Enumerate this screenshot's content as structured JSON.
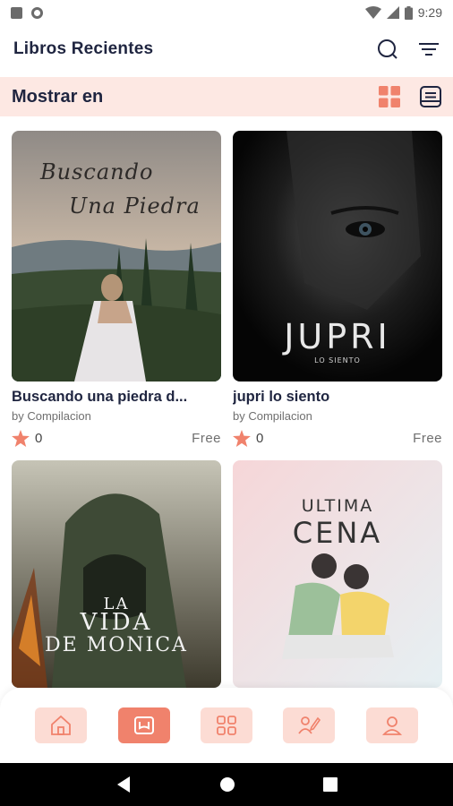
{
  "status_bar": {
    "time": "9:29",
    "icons": [
      "sim-icon",
      "circle-icon",
      "wifi-icon",
      "signal-icon",
      "battery-icon"
    ]
  },
  "header": {
    "title": "Libros Recientes",
    "actions": [
      "search-icon",
      "filter-icon"
    ]
  },
  "view_bar": {
    "label": "Mostrar en",
    "active_view": "grid-view-icon",
    "views": [
      "grid-view-icon",
      "list-view-icon"
    ]
  },
  "books": [
    {
      "title": "Buscando una piedra d...",
      "author": "by Compilacion",
      "rating": "0",
      "price": "Free",
      "cover_text_1": "Buscando",
      "cover_text_2": "Una Piedra"
    },
    {
      "title": "jupri lo siento",
      "author": "by Compilacion",
      "rating": "0",
      "price": "Free",
      "cover_text_1": "JUPRI",
      "cover_text_2": "LO SIENTO"
    },
    {
      "cover_text_1": "LA",
      "cover_text_2": "VIDA",
      "cover_text_3": "DE MONICA"
    },
    {
      "cover_text_1": "ULTIMA",
      "cover_text_2": "CENA"
    }
  ],
  "bottom_nav": {
    "items": [
      "home-icon",
      "book-icon",
      "apps-grid-icon",
      "writing-icon",
      "profile-icon"
    ],
    "active": "book-icon"
  },
  "colors": {
    "accent": "#f0826c",
    "accent_light": "#fcdcd4",
    "bar_bg": "#fde8e3",
    "title": "#1f2540",
    "star": "#f0826c"
  }
}
